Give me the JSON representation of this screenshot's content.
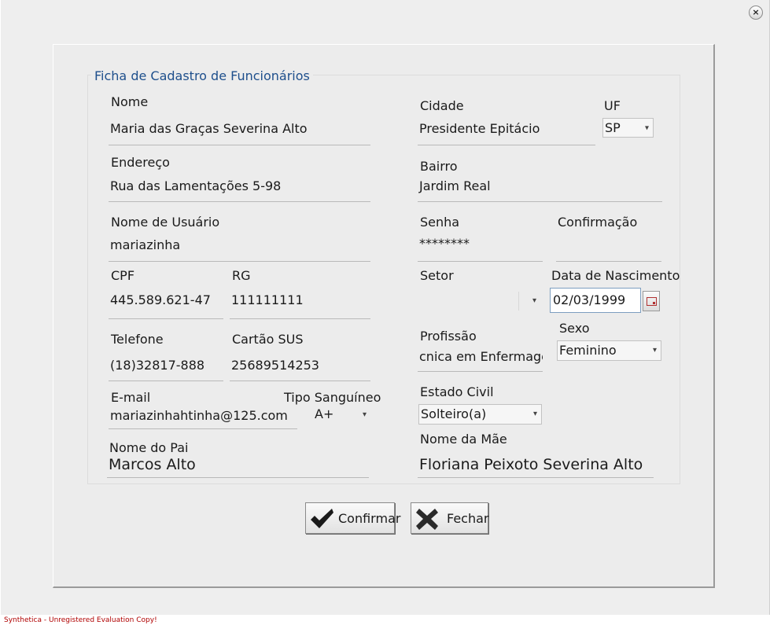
{
  "window": {
    "close_glyph": "×"
  },
  "form": {
    "legend": "Ficha de Cadastro de Funcionários",
    "nome": {
      "label": "Nome",
      "value": "Maria das Graças Severina Alto"
    },
    "cidade": {
      "label": "Cidade",
      "value": "Presidente Epitácio"
    },
    "uf": {
      "label": "UF",
      "value": "SP"
    },
    "endereco": {
      "label": "Endereço",
      "value": "Rua das Lamentações 5-98"
    },
    "bairro": {
      "label": "Bairro",
      "value": "Jardim Real"
    },
    "usuario": {
      "label": "Nome de Usuário",
      "value": "mariazinha"
    },
    "senha": {
      "label": "Senha",
      "value": "********"
    },
    "confirmacao": {
      "label": "Confirmação",
      "value": ""
    },
    "cpf": {
      "label": "CPF",
      "value": "445.589.621-47"
    },
    "rg": {
      "label": "RG",
      "value": "111111111"
    },
    "setor": {
      "label": "Setor",
      "value": ""
    },
    "data_nascimento": {
      "label": "Data de Nascimento",
      "value": "02/03/1999"
    },
    "telefone": {
      "label": "Telefone",
      "value": "(18)32817-888"
    },
    "cartao_sus": {
      "label": "Cartão SUS",
      "value": "25689514253"
    },
    "profissao": {
      "label": "Profissão",
      "value": "cnica em Enfermagem"
    },
    "sexo": {
      "label": "Sexo",
      "value": "Feminino"
    },
    "email": {
      "label": "E-mail",
      "value": "mariazinhahtinha@125.com"
    },
    "tipo_sanguineo": {
      "label": "Tipo Sanguíneo",
      "value": "A+"
    },
    "estado_civil": {
      "label": "Estado Civil",
      "value": "Solteiro(a)"
    },
    "nome_pai": {
      "label": "Nome do Pai",
      "value": "Marcos Alto"
    },
    "nome_mae": {
      "label": "Nome da Mãe",
      "value": "Floriana Peixoto Severina Alto"
    }
  },
  "buttons": {
    "confirmar": "Confirmar",
    "fechar": "Fechar"
  },
  "icons": {
    "combo_arrow": "▾",
    "confirm": "checkmark-icon",
    "close": "x-icon",
    "calendar": "calendar-icon"
  },
  "colors": {
    "legend": "#1e4f8c",
    "watermark": "#b00000",
    "check": "#1a1a1a",
    "cross": "#2a2a2a"
  },
  "footer": "Synthetica - Unregistered Evaluation Copy!"
}
